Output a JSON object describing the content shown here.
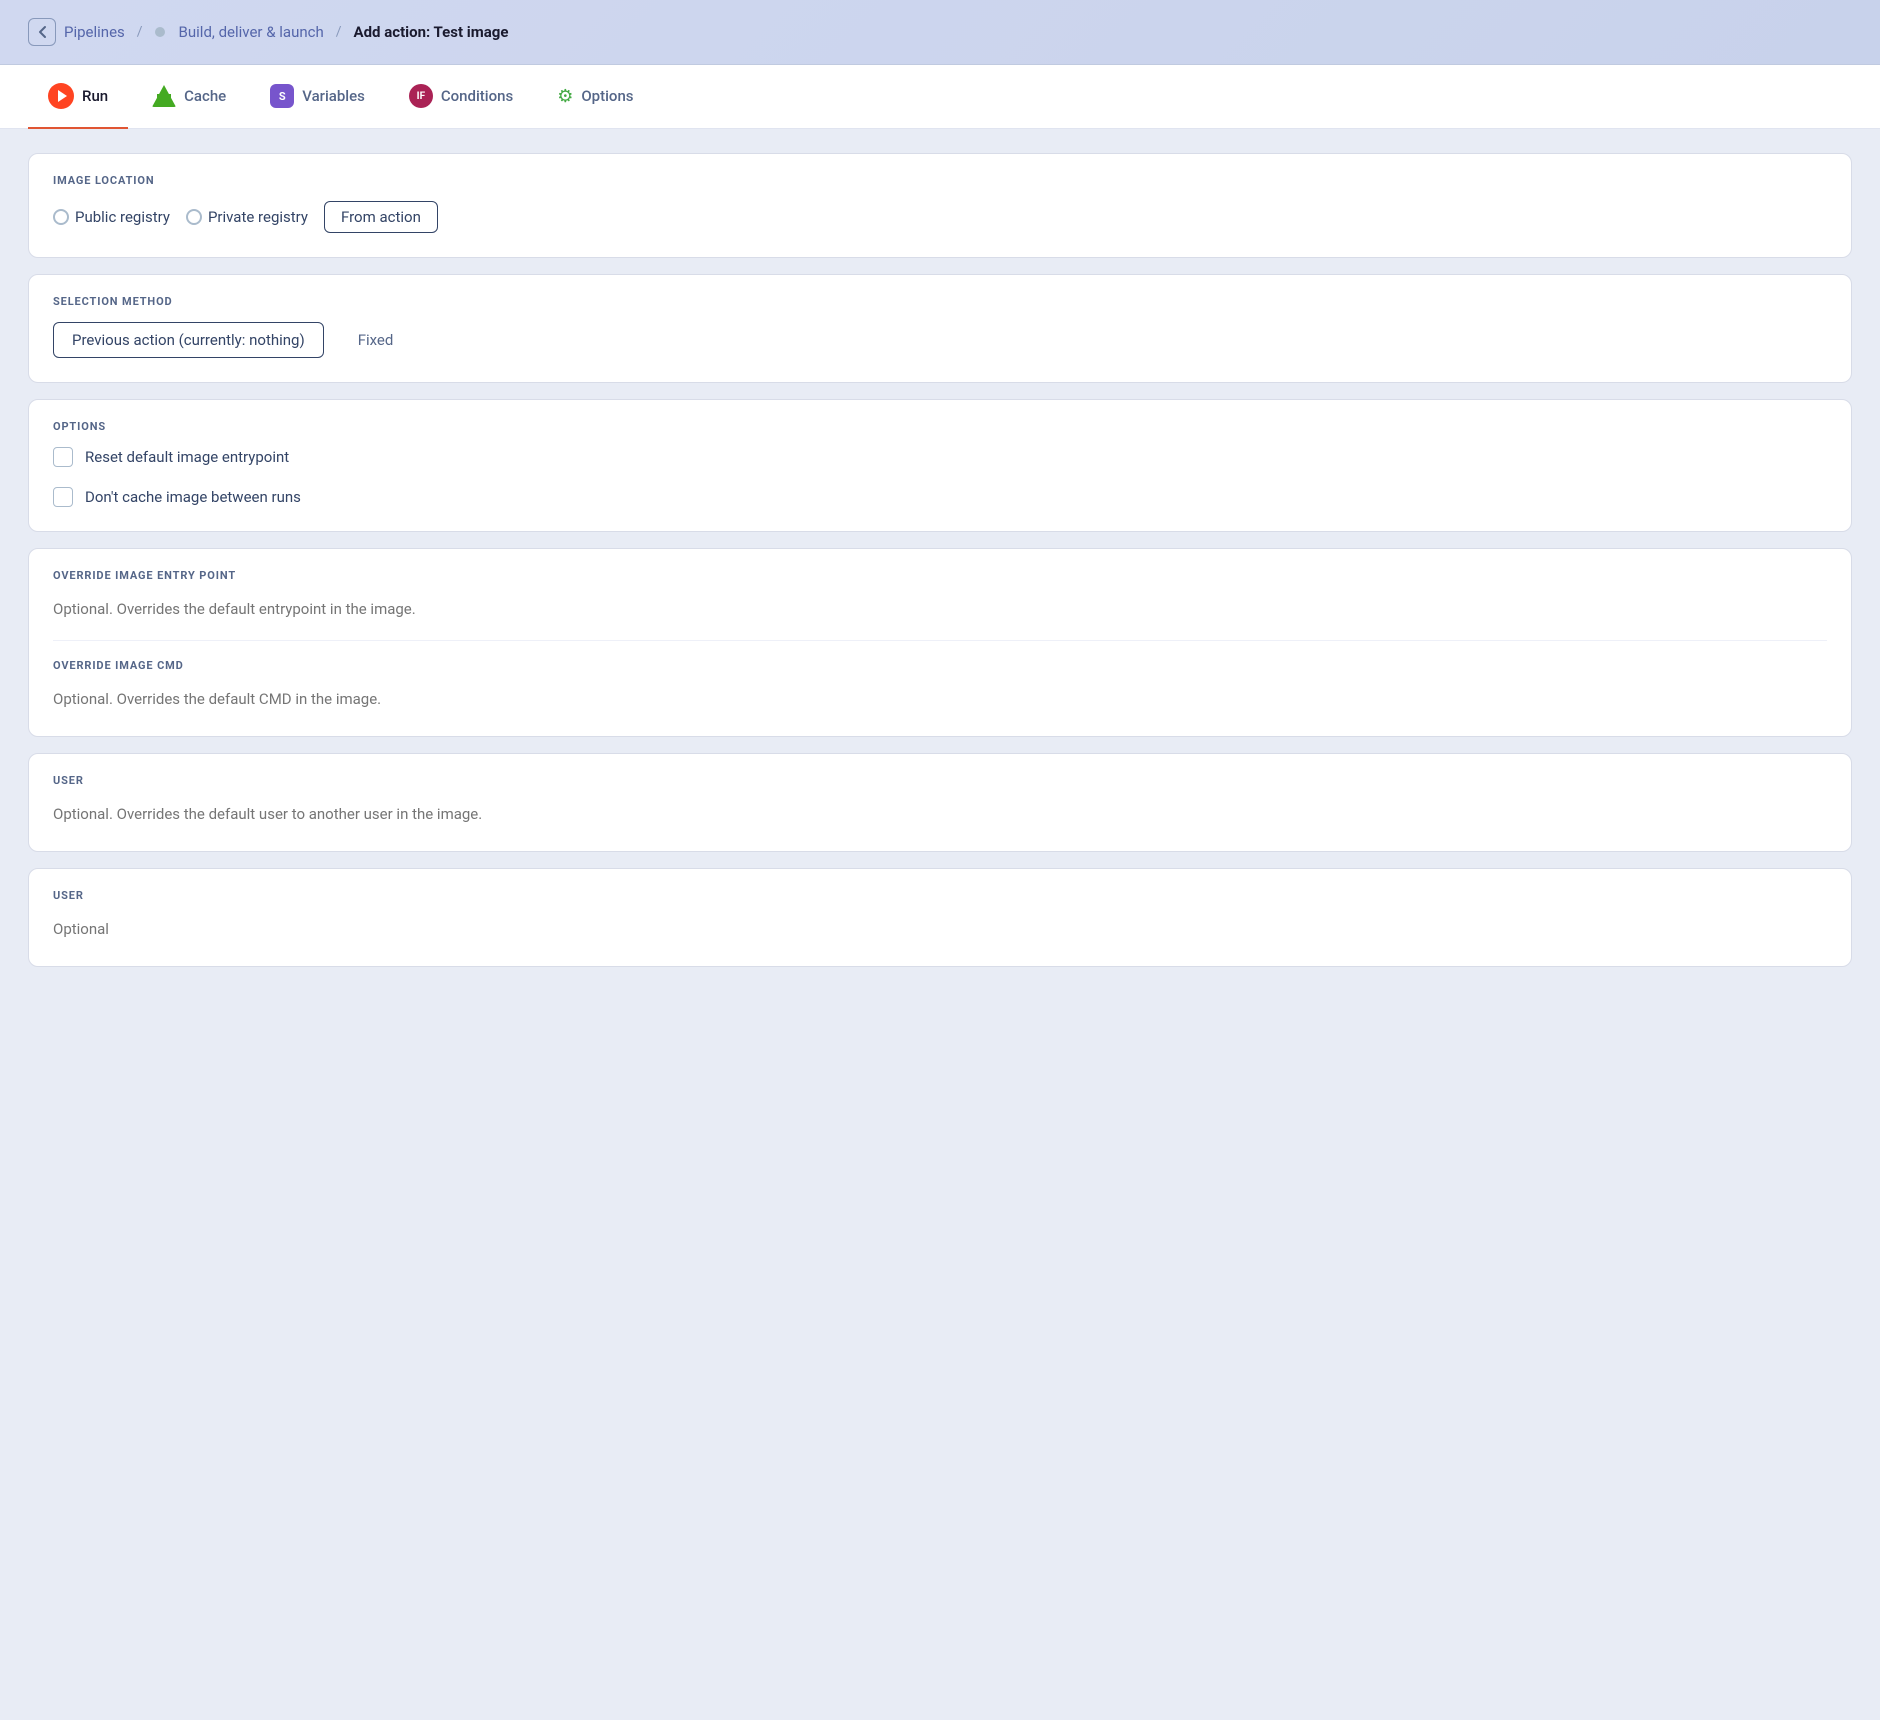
{
  "header": {
    "back_label": "<",
    "breadcrumb": {
      "item1": "Pipelines",
      "sep1": "/",
      "item2": "Build, deliver & launch",
      "sep2": "/",
      "current": "Add action: Test image"
    }
  },
  "tabs": [
    {
      "id": "run",
      "label": "Run",
      "active": true,
      "icon": "run-icon"
    },
    {
      "id": "cache",
      "label": "Cache",
      "active": false,
      "icon": "cache-icon"
    },
    {
      "id": "variables",
      "label": "Variables",
      "active": false,
      "icon": "vars-icon"
    },
    {
      "id": "conditions",
      "label": "Conditions",
      "active": false,
      "icon": "cond-icon"
    },
    {
      "id": "options",
      "label": "Options",
      "active": false,
      "icon": "opts-icon"
    }
  ],
  "image_location": {
    "label": "IMAGE LOCATION",
    "options": [
      {
        "id": "public",
        "label": "Public registry",
        "active": false
      },
      {
        "id": "private",
        "label": "Private registry",
        "active": false
      },
      {
        "id": "from_action",
        "label": "From action",
        "active": true
      }
    ]
  },
  "selection_method": {
    "label": "SELECTION METHOD",
    "options": [
      {
        "id": "previous",
        "label": "Previous action (currently: nothing)",
        "active": true
      },
      {
        "id": "fixed",
        "label": "Fixed",
        "active": false
      }
    ]
  },
  "options_section": {
    "label": "OPTIONS",
    "checkboxes": [
      {
        "id": "reset_entrypoint",
        "label": "Reset default image entrypoint",
        "checked": false
      },
      {
        "id": "no_cache",
        "label": "Don't cache image between runs",
        "checked": false
      }
    ]
  },
  "override_entry_point": {
    "label": "OVERRIDE IMAGE ENTRY POINT",
    "placeholder": "Optional. Overrides the default entrypoint in the image."
  },
  "override_cmd": {
    "label": "OVERRIDE IMAGE CMD",
    "placeholder": "Optional. Overrides the default CMD in the image."
  },
  "user_section1": {
    "label": "USER",
    "placeholder": "Optional. Overrides the default user to another user in the image."
  },
  "user_section2": {
    "label": "USER",
    "placeholder": "Optional"
  }
}
